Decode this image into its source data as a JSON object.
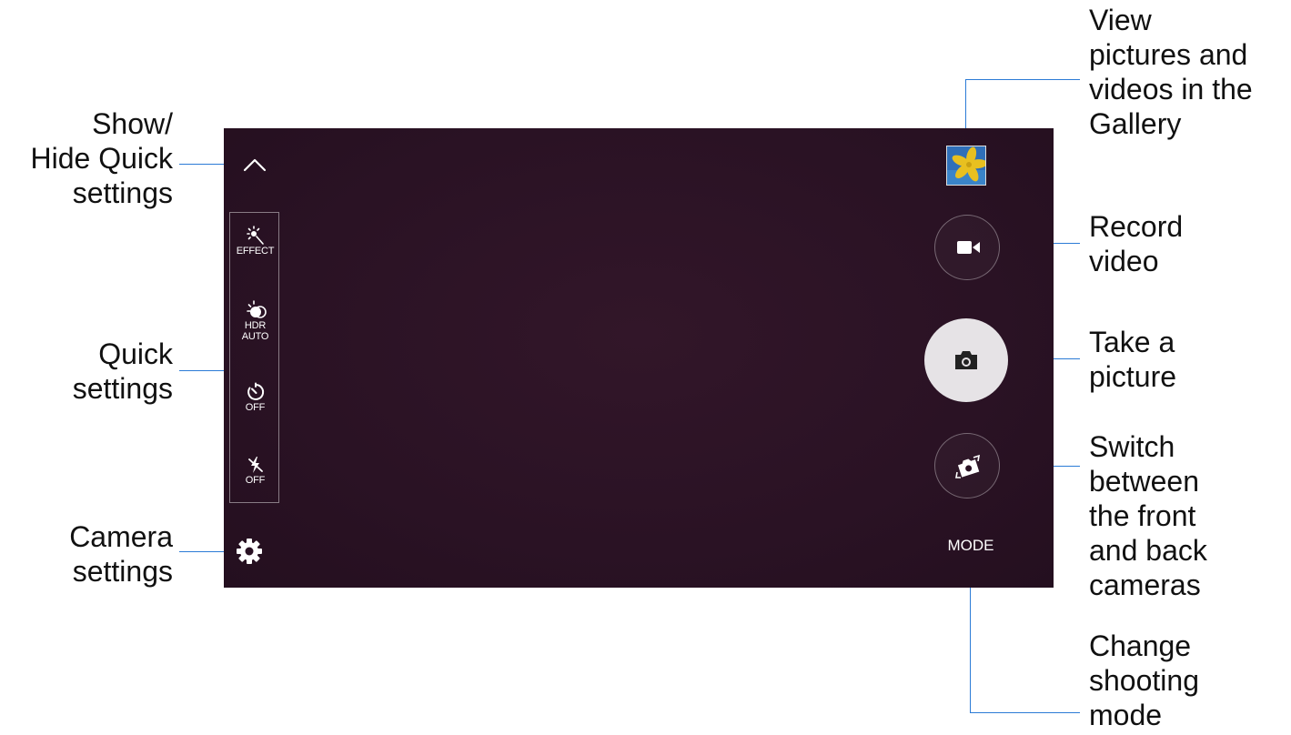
{
  "callouts": {
    "show_hide": [
      "Show/",
      "Hide Quick",
      "settings"
    ],
    "quick_settings": [
      "Quick",
      "settings"
    ],
    "camera_settings": [
      "Camera",
      "settings"
    ],
    "gallery": [
      "View",
      "pictures and",
      "videos in the",
      "Gallery"
    ],
    "record": [
      "Record",
      "video"
    ],
    "take": [
      "Take a",
      "picture"
    ],
    "switch": [
      "Switch",
      "between",
      "the front",
      "and back",
      "cameras"
    ],
    "mode": [
      "Change",
      "shooting",
      "mode"
    ]
  },
  "quick_settings": [
    {
      "icon": "effect-icon",
      "label": "EFFECT"
    },
    {
      "icon": "hdr-icon",
      "label": "HDR AUTO"
    },
    {
      "icon": "timer-icon",
      "label": "OFF"
    },
    {
      "icon": "flash-off-icon",
      "label": "OFF"
    }
  ],
  "mode_label": "MODE",
  "colors": {
    "viewfinder": "#2a1224",
    "callout_line": "#2b7bd6",
    "capture_button": "#e6e3e6"
  }
}
